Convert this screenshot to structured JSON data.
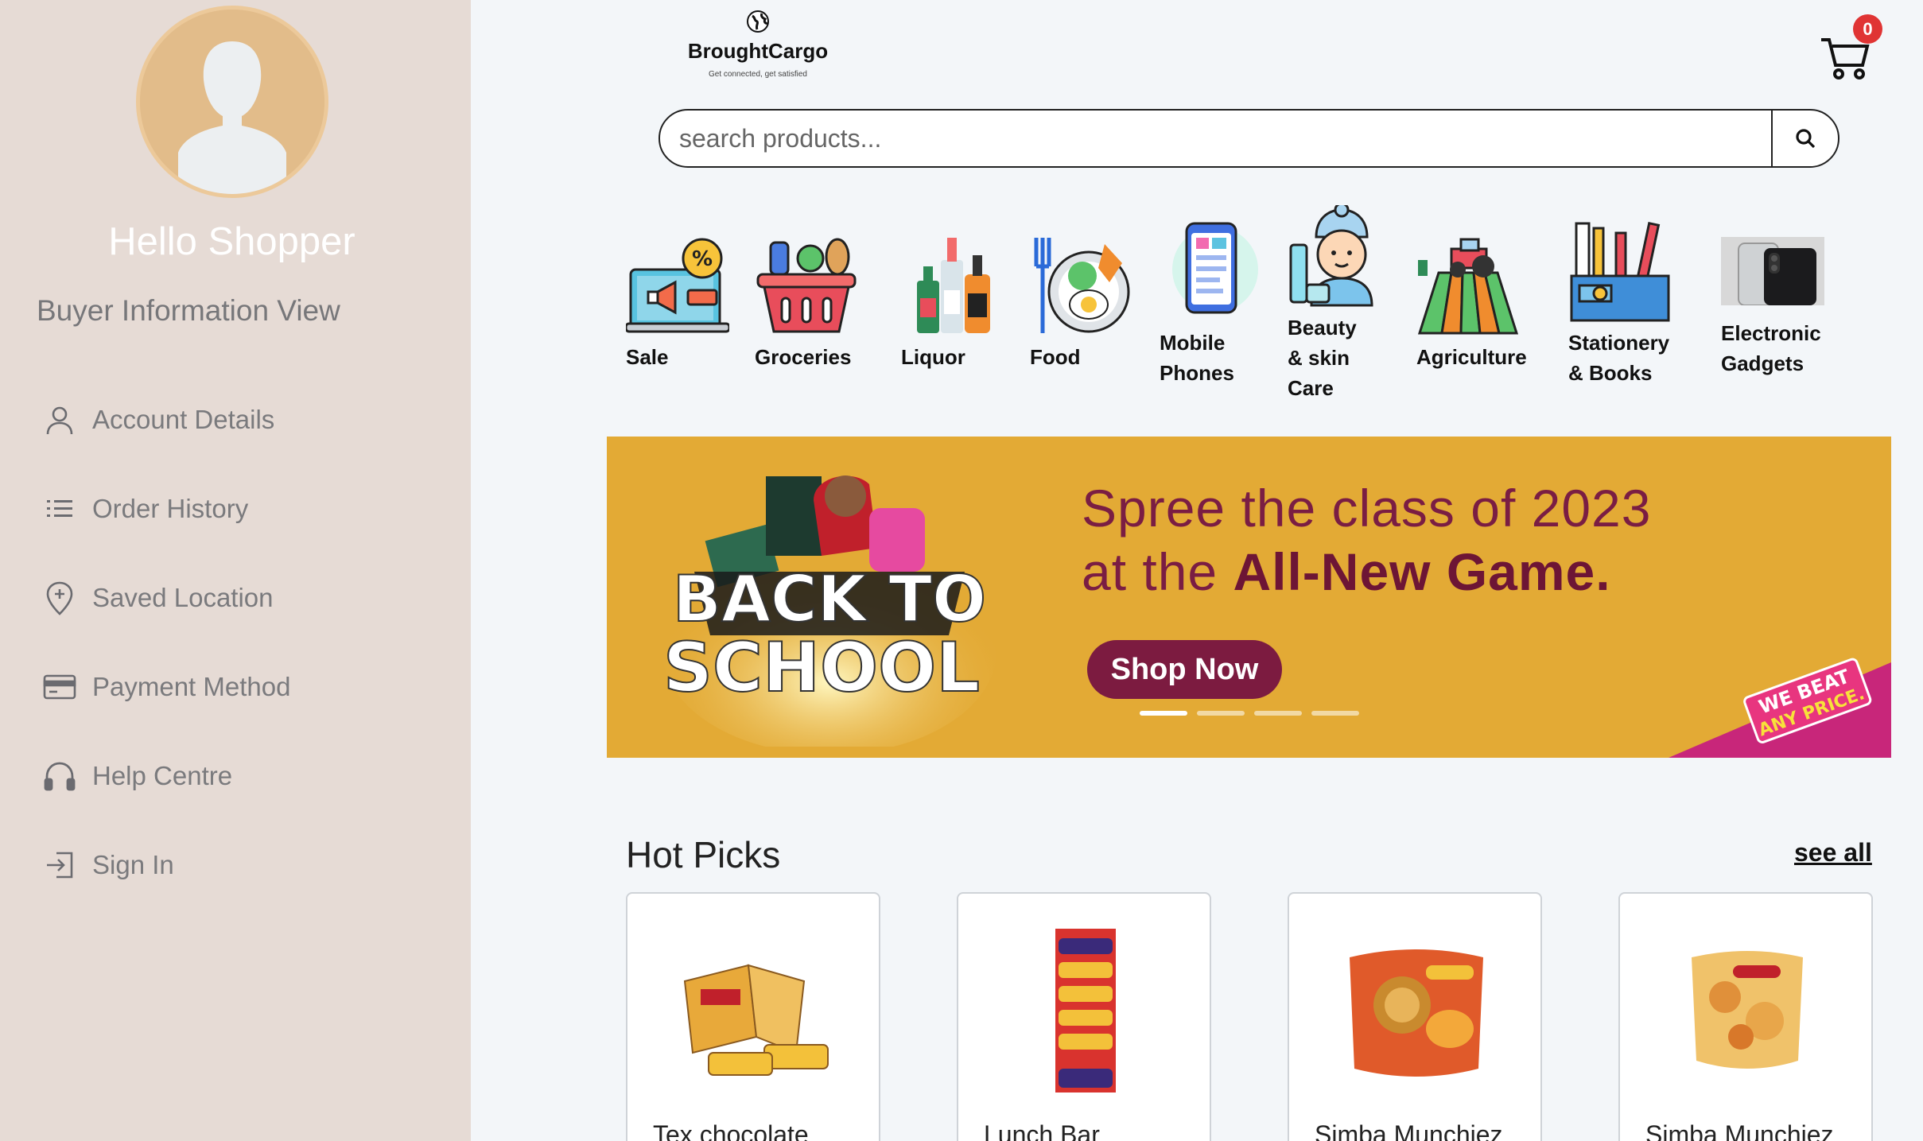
{
  "sidebar": {
    "greeting": "Hello Shopper",
    "view_title": "Buyer Information View",
    "items": [
      {
        "label": "Account Details",
        "icon": "user-icon"
      },
      {
        "label": "Order History",
        "icon": "list-icon"
      },
      {
        "label": "Saved Location",
        "icon": "location-pin-icon"
      },
      {
        "label": "Payment Method",
        "icon": "credit-card-icon"
      },
      {
        "label": "Help Centre",
        "icon": "headphones-icon"
      },
      {
        "label": "Sign In",
        "icon": "sign-in-icon"
      }
    ]
  },
  "header": {
    "logo_name": "BroughtCargo",
    "logo_tagline": "Get connected, get satisfied",
    "cart_count": "0"
  },
  "search": {
    "placeholder": "search products..."
  },
  "categories": [
    {
      "label": "Sale",
      "icon": "sale-icon"
    },
    {
      "label": "Groceries",
      "icon": "grocery-basket-icon"
    },
    {
      "label": "Liquor",
      "icon": "liquor-bottles-icon"
    },
    {
      "label": "Food",
      "icon": "food-plate-icon"
    },
    {
      "label": "Mobile\nPhones",
      "icon": "mobile-phone-icon"
    },
    {
      "label": "Beauty\n& skin\nCare",
      "icon": "beauty-icon"
    },
    {
      "label": "Agriculture",
      "icon": "tractor-field-icon"
    },
    {
      "label": "Stationery\n& Books",
      "icon": "stationery-icon"
    },
    {
      "label": "Electronic\nGadgets",
      "icon": "smartphone-gadget-icon"
    }
  ],
  "banner": {
    "line1": "Spree the class of 2023",
    "line2_prefix": "at the ",
    "line2_bold": "All-New Game.",
    "button_label": "Shop Now",
    "art_text_1": "BACK TO",
    "art_text_2": "SCHOOL",
    "corner_text_1": "WE BEAT",
    "corner_text_2": "ANY PRICE.",
    "active_slide": 1,
    "slide_count": 4
  },
  "hot_picks": {
    "title": "Hot Picks",
    "see_all": "see all",
    "products": [
      {
        "name": "Tex chocolate"
      },
      {
        "name": "Lunch Bar"
      },
      {
        "name": "Simba Munchiez"
      },
      {
        "name": "Simba Munchiez"
      }
    ]
  },
  "colors": {
    "sidebar_bg": "#e6dbd5",
    "page_bg": "#f3f6f9",
    "banner_bg": "#e3aa35",
    "banner_accent": "#7a1d43",
    "cart_badge": "#e03434"
  }
}
